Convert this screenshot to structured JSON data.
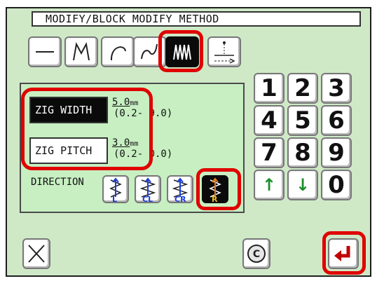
{
  "title": "MODIFY/BLOCK MODIFY  METHOD",
  "zig_width": {
    "label": "ZIG WIDTH",
    "value": "5.0",
    "unit": "mm",
    "range": "(0.2- 9.0)"
  },
  "zig_pitch": {
    "label": "ZIG PITCH",
    "value": "3.0",
    "unit": "mm",
    "range": "(0.2- 0.0)"
  },
  "direction": {
    "label": "DIRECTION",
    "buttons": [
      "L",
      "CL",
      "CR",
      "R"
    ],
    "selected": "R"
  },
  "keypad": {
    "keys": [
      "1",
      "2",
      "3",
      "4",
      "5",
      "6",
      "7",
      "8",
      "9",
      "↑",
      "↓",
      "0"
    ]
  },
  "colors": {
    "background": "#cfe9c7",
    "highlight": "#e00000",
    "selected": "#0a0a0a",
    "accent": "#1a3fd6"
  },
  "icons": [
    "line-type-icon",
    "polyline-type-icon",
    "arc-type-icon",
    "curve-type-icon",
    "zigzag-type-icon",
    "offset-type-icon",
    "close-icon",
    "clear-icon",
    "enter-icon"
  ]
}
